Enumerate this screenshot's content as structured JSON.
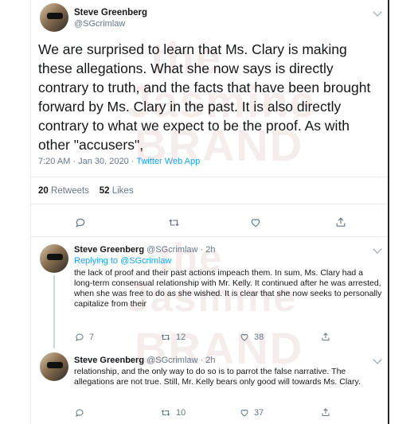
{
  "main_tweet": {
    "author_name": "Steve Greenberg",
    "author_handle": "@SGcrimlaw",
    "text": "We are surprised to learn that Ms. Clary is making these allegations.  What she now says is directly contrary to truth, and the facts that have been brought forward by Ms. Clary in the past. It is also directly contrary to what we expect to be the proof. As with other \"accusers\",",
    "time": "7:20 AM · Jan 30, 2020 · ",
    "app": "Twitter Web App",
    "retweets_count": "20",
    "retweets_label": "Retweets",
    "likes_count": "52",
    "likes_label": "Likes"
  },
  "replies": [
    {
      "author_name": "Steve Greenberg",
      "meta": "@SGcrimlaw · 2h",
      "replying_to": "Replying to @SGcrimlaw",
      "text": "the lack of proof and their past actions impeach them. In sum, Ms. Clary had a long-term consensual relationship with Mr. Kelly. It continued after he was arrested, when she was free to do as she wished. It is clear that she now seeks to personally capitalize from their",
      "reply_count": "7",
      "retweet_count": "12",
      "like_count": "38"
    },
    {
      "author_name": "Steve Greenberg",
      "meta": "@SGcrimlaw · 2h",
      "text": "relationship, and the only way to do so is to parrot the false narrative. The allegations are not true. Still, Mr. Kelly bears only good will towards Ms. Clary.",
      "reply_count": "",
      "retweet_count": "10",
      "like_count": "37"
    }
  ],
  "icons": [
    "reply-icon",
    "retweet-icon",
    "like-icon",
    "share-icon",
    "chevron-down-icon"
  ],
  "colors": {
    "link": "#1da1f2",
    "muted": "#657786",
    "divider": "#e6ecf0"
  }
}
